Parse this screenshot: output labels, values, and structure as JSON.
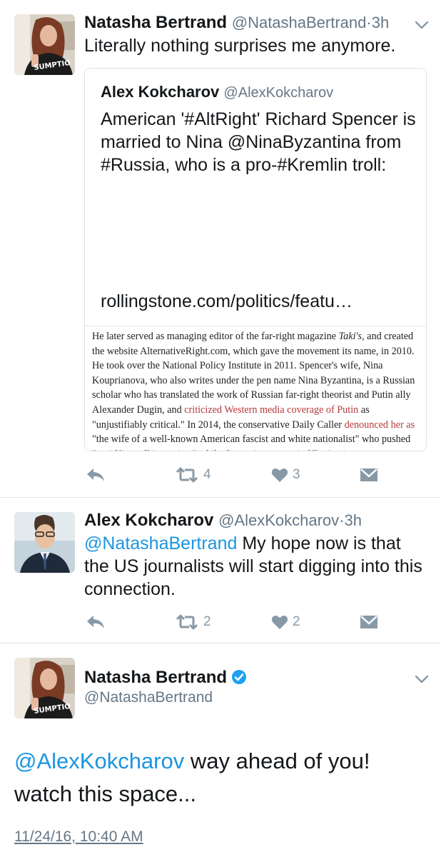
{
  "tweet1": {
    "name": "Natasha Bertrand",
    "handle": "@NatashaBertrand",
    "separator": "·",
    "time": "3h",
    "text": "Literally nothing surprises me anymore.",
    "avatar_shirt_text": "SUMPTIO",
    "quote": {
      "name": "Alex Kokcharov",
      "handle": "@AlexKokcharov",
      "text": "American '#AltRight' Richard Spencer is married to Nina @NinaByzantina from #Russia, who is a pro-#Kremlin troll:",
      "url": "rollingstone.com/politics/featu…",
      "article": {
        "p1": "He later served as managing editor of the far-right magazine ",
        "p1_italic": "Taki's",
        "p2": ", and created the website AlternativeRight.com, which gave the movement its name, in 2010. He took over the National Policy Institute in 2011. Spencer's wife, Nina Kouprianova, who also writes under the pen name Nina Byzantina, is a Russian scholar who has translated the work of Russian far-right theorist and Putin ally Alexander Dugin, and ",
        "link1": "criticized Western media coverage of Putin",
        "p3": " as \"unjustifiably critical.\" In 2014, the conservative Daily Caller ",
        "link2": "denounced her as",
        "p4": " \"the wife of a well-known American fascist and white nationalist\" who pushed \"anti-Kiev talking points\" while discussing events in Ukraine in an appearance on the Kremlin-backed, English-language outlet Russia Today."
      }
    },
    "actions": {
      "retweets": "4",
      "likes": "3"
    }
  },
  "tweet2": {
    "name": "Alex Kokcharov",
    "handle": "@AlexKokcharov",
    "separator": "·",
    "time": "3h",
    "mention": "@NatashaBertrand",
    "text": " My hope now is that the US journalists will start digging into this connection.",
    "actions": {
      "retweets": "2",
      "likes": "2"
    }
  },
  "tweet3": {
    "name": "Natasha Bertrand",
    "handle": "@NatashaBertrand",
    "mention": "@AlexKokcharov",
    "text": " way ahead of you! watch this space...",
    "timestamp": "11/24/16, 10:40 AM",
    "avatar_shirt_text": "SUMPTIO"
  },
  "colors": {
    "link": "#1b95e0",
    "secondary_text": "#657786",
    "action_icon": "#8899a6",
    "article_link": "#b5383a"
  },
  "icons": {
    "reply": "reply-icon",
    "retweet": "retweet-icon",
    "like": "heart-icon",
    "dm": "envelope-icon",
    "more": "chevron-down-icon",
    "verified": "verified-badge-icon"
  }
}
